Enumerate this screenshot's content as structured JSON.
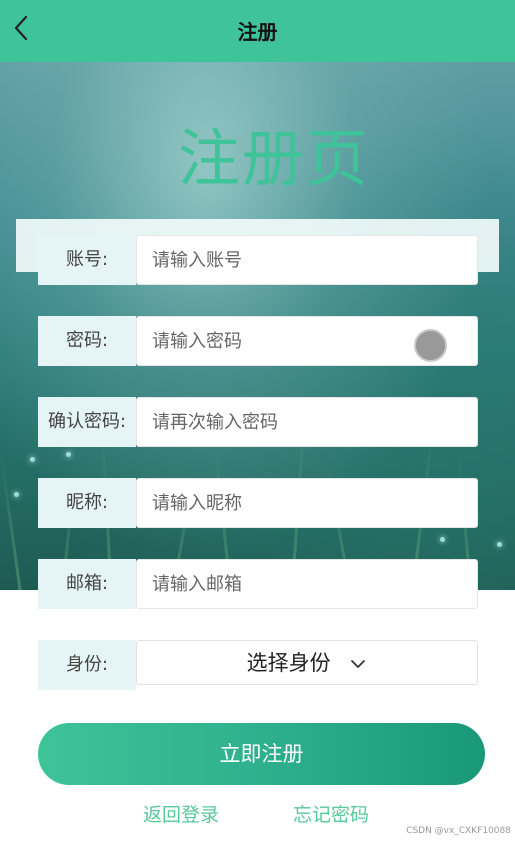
{
  "header": {
    "title": "注册",
    "back_icon": "chevron-left-icon",
    "background_color": "#3fc398"
  },
  "page_title": "注册页",
  "form": {
    "account": {
      "label": "账号:",
      "placeholder": "请输入账号"
    },
    "password": {
      "label": "密码:",
      "placeholder": "请输入密码",
      "toggle_icon": "visibility-toggle-icon"
    },
    "confirm_password": {
      "label": "确认密码:",
      "placeholder": "请再次输入密码"
    },
    "nickname": {
      "label": "昵称:",
      "placeholder": "请输入昵称"
    },
    "email": {
      "label": "邮箱:",
      "placeholder": "请输入邮箱"
    },
    "role": {
      "label": "身份:",
      "selected": "选择身份",
      "icon": "chevron-down-icon"
    }
  },
  "actions": {
    "submit_label": "立即注册",
    "back_to_login": "返回登录",
    "forgot_password": "忘记密码"
  },
  "watermark": "CSDN @vx_CXKF10088",
  "colors": {
    "accent": "#3fc398",
    "link": "#57c99a",
    "label_bg": "#e5f5f5"
  }
}
